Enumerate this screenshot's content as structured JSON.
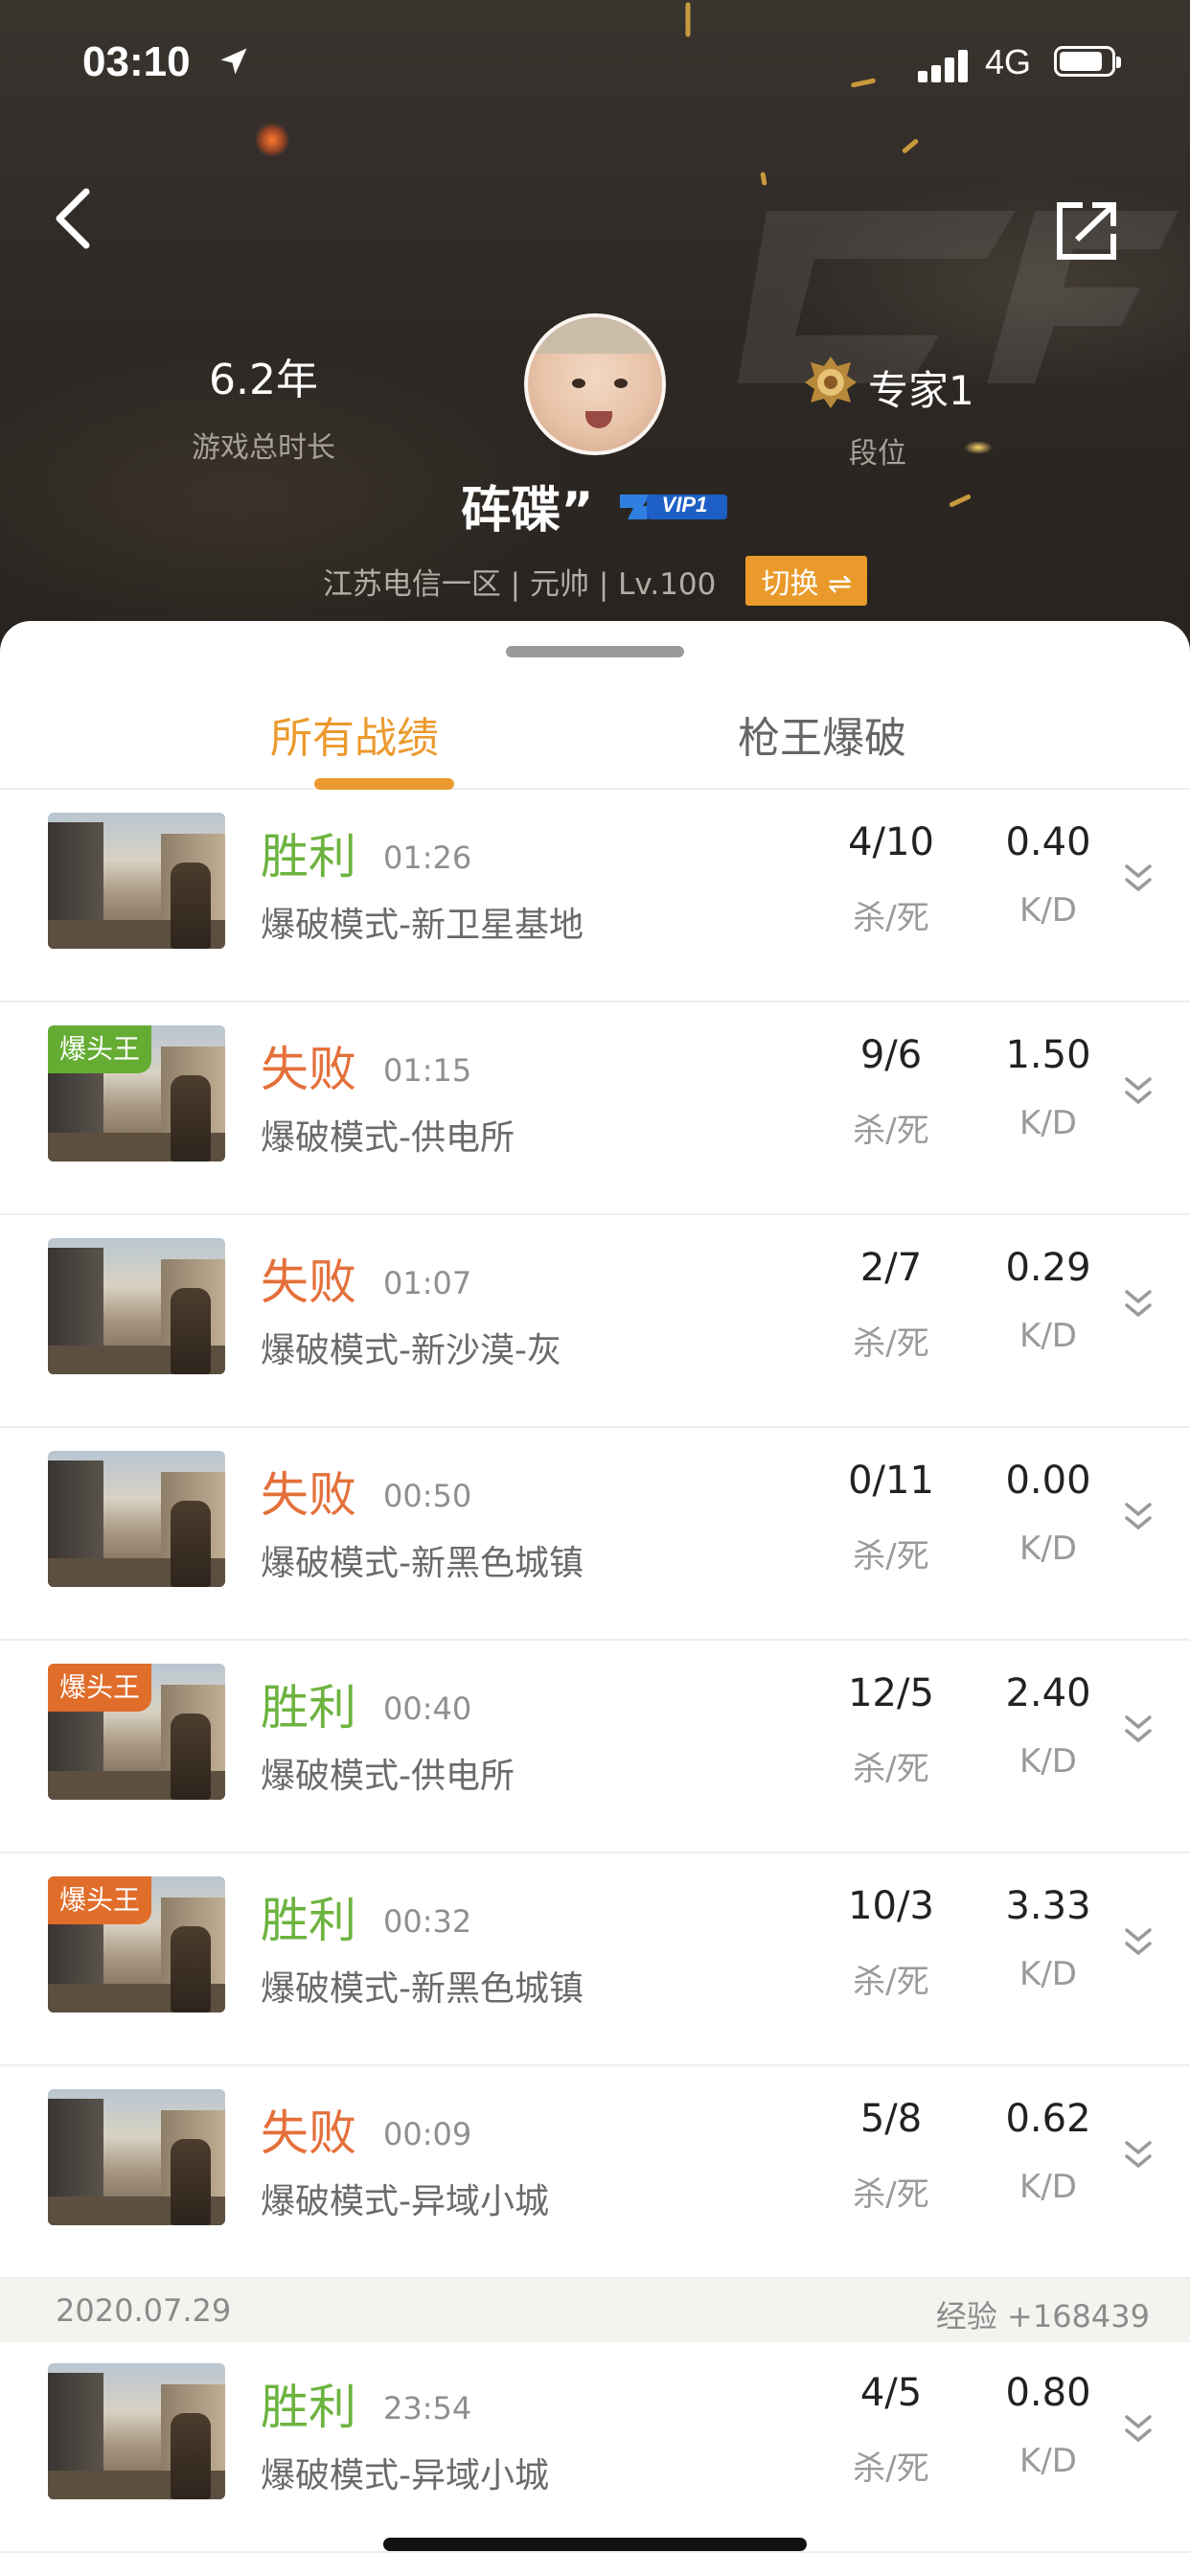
{
  "status_bar": {
    "time": "03:10",
    "network": "4G"
  },
  "profile": {
    "play_time_value": "6.2年",
    "play_time_label": "游戏总时长",
    "rank_value": "专家1",
    "rank_label": "段位",
    "nickname": "砗碟”",
    "vip_label": "VIP1",
    "server_info": "江苏电信一区 | 元帅 | Lv.100",
    "switch_label": "切换 ⇌"
  },
  "tabs": [
    {
      "label": "所有战绩",
      "active": true
    },
    {
      "label": "枪王爆破",
      "active": false
    }
  ],
  "labels": {
    "kills_deaths": "杀/死",
    "kd": "K/D"
  },
  "matches": [
    {
      "result": "胜利",
      "outcome": "win",
      "time": "01:26",
      "mode": "爆破模式-新卫星基地",
      "kills_deaths": "4/10",
      "kd": "0.40",
      "badge": "",
      "badge_color": ""
    },
    {
      "result": "失败",
      "outcome": "lose",
      "time": "01:15",
      "mode": "爆破模式-供电所",
      "kills_deaths": "9/6",
      "kd": "1.50",
      "badge": "爆头王",
      "badge_color": "green"
    },
    {
      "result": "失败",
      "outcome": "lose",
      "time": "01:07",
      "mode": "爆破模式-新沙漠-灰",
      "kills_deaths": "2/7",
      "kd": "0.29",
      "badge": "",
      "badge_color": ""
    },
    {
      "result": "失败",
      "outcome": "lose",
      "time": "00:50",
      "mode": "爆破模式-新黑色城镇",
      "kills_deaths": "0/11",
      "kd": "0.00",
      "badge": "",
      "badge_color": ""
    },
    {
      "result": "胜利",
      "outcome": "win",
      "time": "00:40",
      "mode": "爆破模式-供电所",
      "kills_deaths": "12/5",
      "kd": "2.40",
      "badge": "爆头王",
      "badge_color": "orange"
    },
    {
      "result": "胜利",
      "outcome": "win",
      "time": "00:32",
      "mode": "爆破模式-新黑色城镇",
      "kills_deaths": "10/3",
      "kd": "3.33",
      "badge": "爆头王",
      "badge_color": "orange"
    },
    {
      "result": "失败",
      "outcome": "lose",
      "time": "00:09",
      "mode": "爆破模式-异域小城",
      "kills_deaths": "5/8",
      "kd": "0.62",
      "badge": "",
      "badge_color": ""
    }
  ],
  "date_separator": {
    "date": "2020.07.29",
    "exp": "经验 +168439"
  },
  "matches_after_separator": [
    {
      "result": "胜利",
      "outcome": "win",
      "time": "23:54",
      "mode": "爆破模式-异域小城",
      "kills_deaths": "4/5",
      "kd": "0.80",
      "badge": "",
      "badge_color": ""
    }
  ],
  "colors": {
    "accent": "#eb9a2f",
    "win": "#6db33f",
    "lose": "#e4703a",
    "badge_green": "#65ac33",
    "badge_orange": "#e06d2a"
  }
}
